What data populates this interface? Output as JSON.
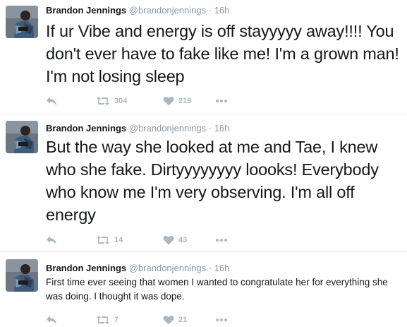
{
  "tweets": [
    {
      "author_name": "Brandon Jennings",
      "handle": "@brandonjennings",
      "separator": "·",
      "time": "16h",
      "text": "If ur Vibe and energy is off stayyyyy away!!!! You don't ever have to fake like me! I'm a grown man! I'm not losing sleep",
      "retweets": "304",
      "likes": "219"
    },
    {
      "author_name": "Brandon Jennings",
      "handle": "@brandonjennings",
      "separator": "·",
      "time": "16h",
      "text": "But the way she looked at me and Tae, I knew who she fake. Dirtyyyyyyyy loooks! Everybody who know me I'm very observing. I'm all off energy",
      "retweets": "14",
      "likes": "43"
    },
    {
      "author_name": "Brandon Jennings",
      "handle": "@brandonjennings",
      "separator": "·",
      "time": "16h",
      "text": "First time ever seeing that women I wanted to congratulate her for everything she was doing. I thought it was dope.",
      "retweets": "7",
      "likes": "21"
    }
  ],
  "icons": {
    "reply": "reply-icon",
    "retweet": "retweet-icon",
    "like": "heart-icon",
    "more": "more-icon"
  },
  "colors": {
    "text": "#14171a",
    "secondary": "#8899a6",
    "action": "#aab8c2",
    "divider": "#e6ecf0"
  }
}
